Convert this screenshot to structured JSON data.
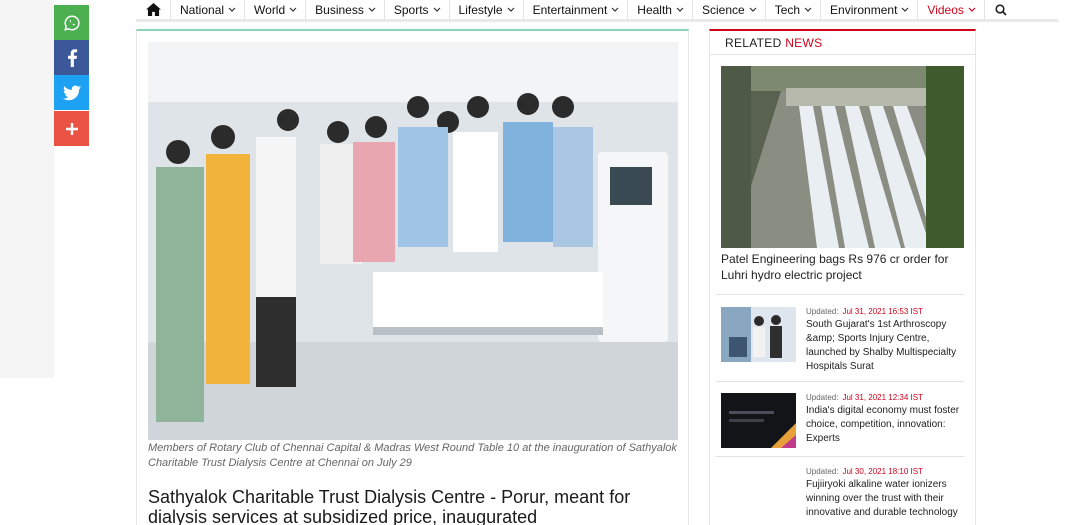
{
  "nav": {
    "home_icon": "home-icon",
    "items": [
      {
        "label": "National"
      },
      {
        "label": "World"
      },
      {
        "label": "Business"
      },
      {
        "label": "Sports"
      },
      {
        "label": "Lifestyle"
      },
      {
        "label": "Entertainment"
      },
      {
        "label": "Health"
      },
      {
        "label": "Science"
      },
      {
        "label": "Tech"
      },
      {
        "label": "Environment"
      },
      {
        "label": "Videos"
      }
    ],
    "active_color": "#d0021b",
    "search_icon": "search-icon"
  },
  "share": {
    "whatsapp_color": "#4caf50",
    "facebook_color": "#3b5998",
    "twitter_color": "#1da1f2",
    "more_color": "#e85344"
  },
  "article": {
    "caption": "Members of Rotary Club of Chennai Capital & Madras West Round Table 10 at the inauguration of Sathyalok Charitable Trust Dialysis Centre at Chennai on July 29",
    "headline": "Sathyalok Charitable Trust Dialysis Centre - Porur, meant for dialysis services at subsidized price, inaugurated"
  },
  "related": {
    "title_prefix": "RELATED",
    "title_accent": "NEWS",
    "featured_title": "Patel Engineering bags Rs 976 cr order for Luhri hydro electric project",
    "items": [
      {
        "updated_label": "Updated:",
        "date": "Jul 31, 2021 16:53 IST",
        "title": "South Gujarat's 1st Arthroscopy &amp; Sports Injury Centre, launched by Shalby Multispecialty Hospitals Surat"
      },
      {
        "updated_label": "Updated:",
        "date": "Jul 31, 2021 12:34 IST",
        "title": "India's digital economy must foster choice, competition, innovation: Experts"
      },
      {
        "updated_label": "Updated:",
        "date": "Jul 30, 2021 18:10 IST",
        "title": "Fujiiryoki alkaline water ionizers winning over the trust with their innovative and durable technology"
      }
    ]
  }
}
